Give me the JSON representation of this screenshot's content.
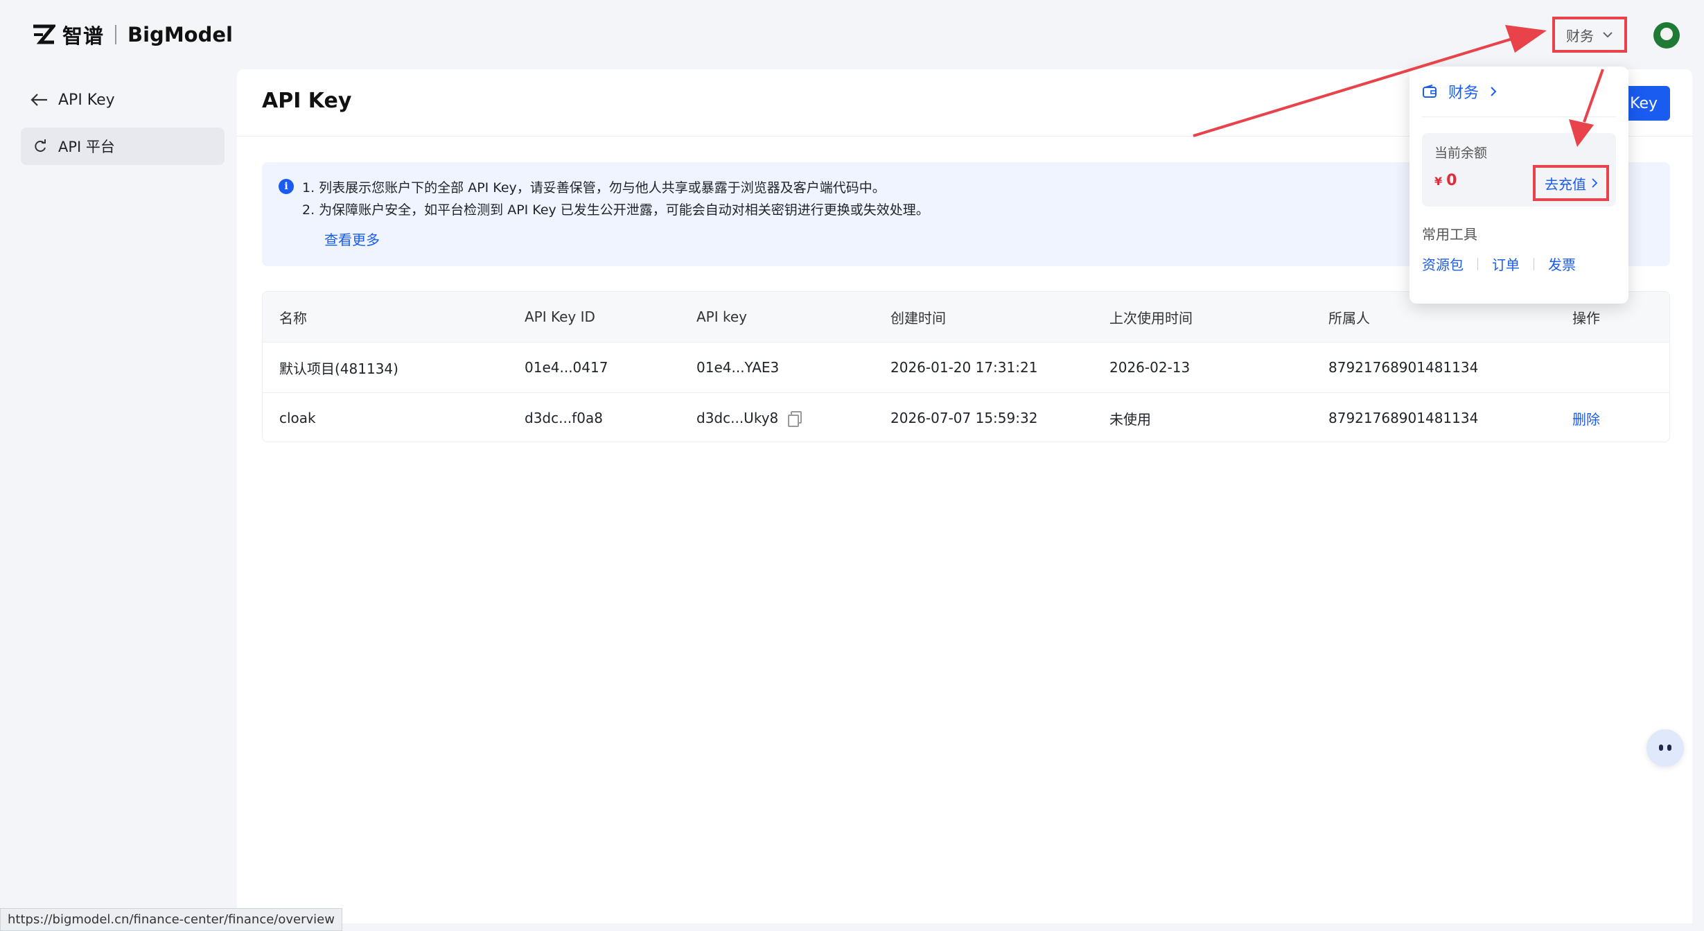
{
  "header": {
    "logo_cn": "智谱",
    "logo_en": "BigModel",
    "finance_label": "财务"
  },
  "sidebar": {
    "back_label": "API Key",
    "items": [
      {
        "label": "API 平台"
      }
    ]
  },
  "main": {
    "title": "API Key",
    "create_button_label": "Key",
    "notice": {
      "line1": "1. 列表展示您账户下的全部 API Key，请妥善保管，勿与他人共享或暴露于浏览器及客户端代码中。",
      "line2": "2. 为保障账户安全，如平台检测到 API Key 已发生公开泄露，可能会自动对相关密钥进行更换或失效处理。",
      "more_link": "查看更多"
    },
    "table": {
      "columns": [
        "名称",
        "API Key ID",
        "API key",
        "创建时间",
        "上次使用时间",
        "所属人",
        "操作"
      ],
      "rows": [
        {
          "name": "默认项目(481134)",
          "key_id": "01e4...0417",
          "api_key": "01e4...YAE3",
          "created": "2026-01-20 17:31:21",
          "last_used": "2026-02-13",
          "owner": "87921768901481134",
          "action": ""
        },
        {
          "name": "cloak",
          "key_id": "d3dc...f0a8",
          "api_key": "d3dc...Uky8",
          "created": "2026-07-07 15:59:32",
          "last_used": "未使用",
          "owner": "87921768901481134",
          "action": "删除"
        }
      ]
    }
  },
  "dropdown": {
    "title": "财务",
    "balance_label": "当前余额",
    "currency_symbol": "¥",
    "balance_value": "0",
    "recharge_label": "去充值",
    "tools_label": "常用工具",
    "tools": [
      "资源包",
      "订单",
      "发票"
    ]
  },
  "status_bar": {
    "url": "https://bigmodel.cn/finance-center/finance/overview"
  },
  "colors": {
    "accent": "#1a5bf0",
    "annotation": "#e8424a",
    "balance": "#e02b38"
  }
}
